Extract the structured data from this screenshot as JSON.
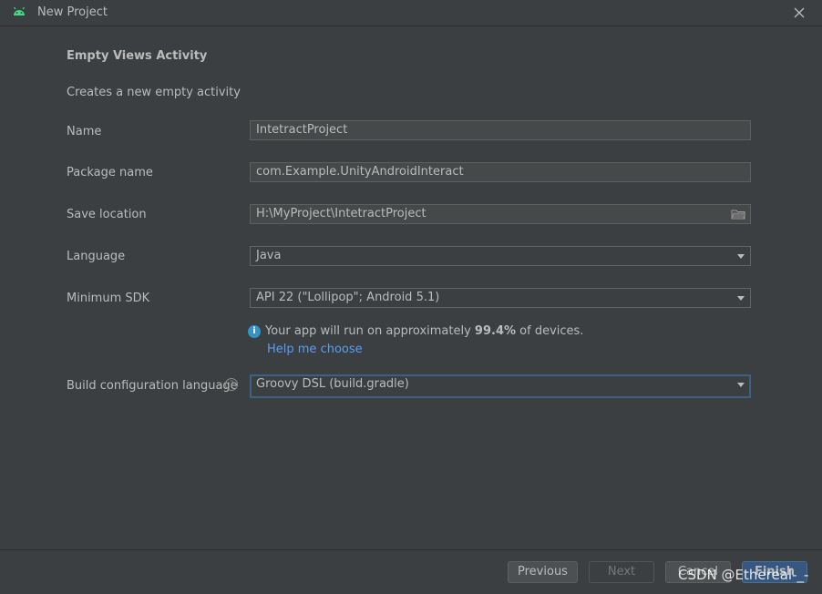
{
  "window": {
    "title": "New Project",
    "logo_icon": "android-icon",
    "close_icon": "close-icon"
  },
  "template": {
    "heading": "Empty Views Activity",
    "description": "Creates a new empty activity"
  },
  "form": {
    "name": {
      "label": "Name",
      "value": "IntetractProject"
    },
    "package": {
      "label": "Package name",
      "value": "com.Example.UnityAndroidInteract"
    },
    "save_location": {
      "label": "Save location",
      "value": "H:\\MyProject\\IntetractProject",
      "icon": "folder-icon"
    },
    "language": {
      "label": "Language",
      "value": "Java"
    },
    "min_sdk": {
      "label": "Minimum SDK",
      "value": "API 22 (\"Lollipop\"; Android 5.1)"
    },
    "build_config": {
      "label": "Build configuration language",
      "value": "Groovy DSL (build.gradle)",
      "help_icon": "question-icon"
    }
  },
  "info": {
    "icon": "info-icon",
    "text_before": "Your app will run on approximately ",
    "percentage": "99.4%",
    "text_after": " of devices.",
    "help_link": "Help me choose"
  },
  "buttons": {
    "previous": "Previous",
    "next": "Next",
    "cancel": "Cancel",
    "finish": "Finish"
  },
  "watermark": "CSDN @Ethereal-_-",
  "colors": {
    "background": "#3c3f41",
    "field_bg": "#45494a",
    "link": "#589df6",
    "info": "#3592c4",
    "primary_button": "#365880",
    "focus_border": "#3d6185"
  }
}
